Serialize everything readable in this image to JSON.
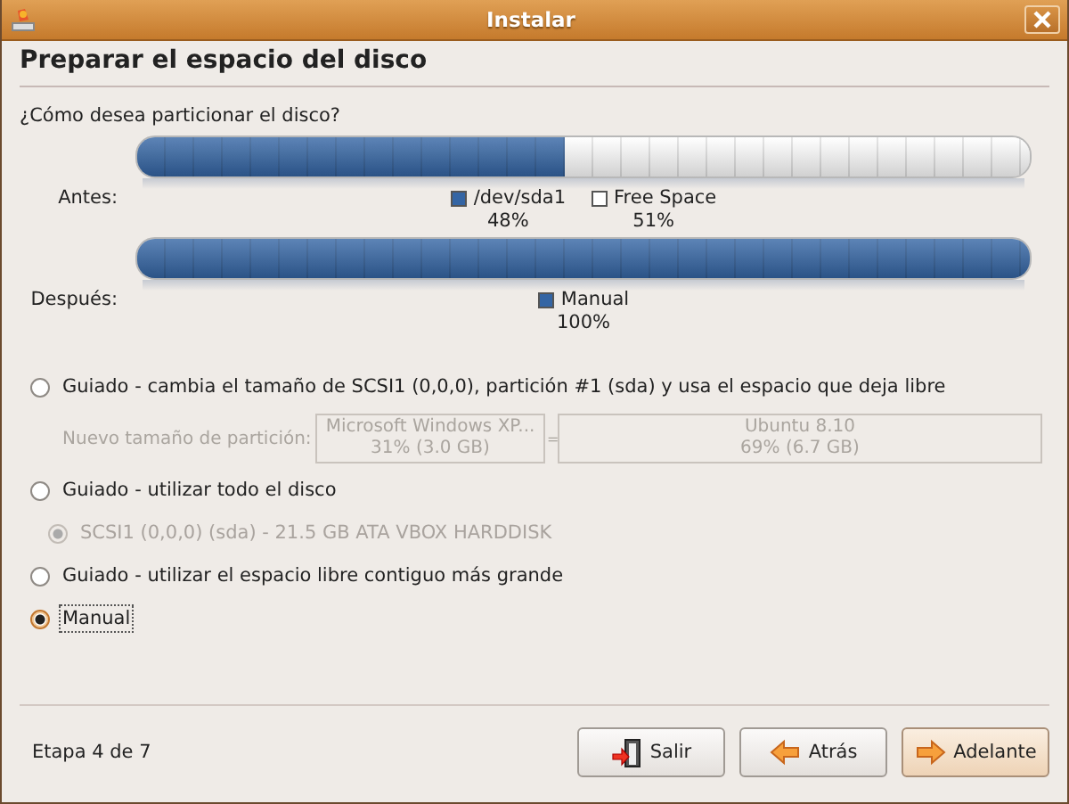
{
  "window": {
    "title": "Instalar"
  },
  "heading": "Preparar el espacio del disco",
  "question": "¿Cómo desea particionar el disco?",
  "disk_bars": [
    {
      "label": "Antes:",
      "segments": [
        {
          "name": "/dev/sda1",
          "percent": "48%",
          "color": "#3465a4",
          "level": 0.48
        },
        {
          "name": "Free Space",
          "percent": "51%",
          "color": "#ffffff",
          "level": 0.52
        }
      ]
    },
    {
      "label": "Después:",
      "segments": [
        {
          "name": "Manual",
          "percent": "100%",
          "color": "#3465a4",
          "level": 1
        }
      ]
    }
  ],
  "options": [
    {
      "label": "Guiado - cambia el tamaño de SCSI1 (0,0,0), partición #1 (sda) y usa el espacio que deja libre",
      "selected": false,
      "focused": false,
      "resize": {
        "label": "Nuevo tamaño de partición:",
        "disabled": true,
        "left": {
          "name": "Microsoft Windows XP...",
          "size": "31% (3.0 GB)"
        },
        "separator": "=",
        "right": {
          "name": "Ubuntu 8.10",
          "size": "69% (6.7 GB)"
        }
      }
    },
    {
      "label": "Guiado - utilizar todo el disco",
      "selected": false,
      "focused": false,
      "children": [
        {
          "label": "SCSI1 (0,0,0) (sda) - 21.5 GB ATA VBOX HARDDISK",
          "selected": true,
          "disabled": true
        }
      ]
    },
    {
      "label": "Guiado - utilizar el espacio libre contiguo más grande",
      "selected": false,
      "focused": false
    },
    {
      "label": "Manual",
      "selected": true,
      "focused": true
    }
  ],
  "step": "Etapa 4 de 7",
  "buttons": [
    {
      "label": "Salir",
      "default": false
    },
    {
      "label": "Atrás",
      "default": false
    },
    {
      "label": "Adelante",
      "default": true
    }
  ]
}
